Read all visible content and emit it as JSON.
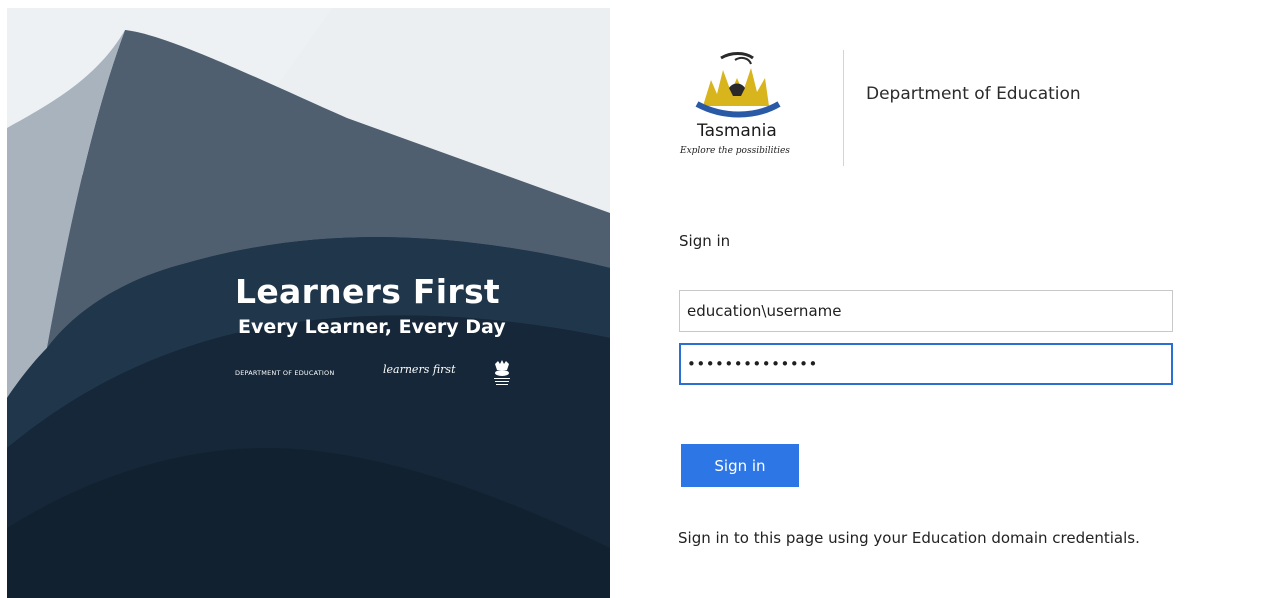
{
  "left_panel": {
    "title": "Learners First",
    "subtitle": "Every Learner, Every Day",
    "department": "DEPARTMENT OF EDUCATION",
    "wordmark": "learners first",
    "colors": {
      "background": "#152738",
      "shape_light": "#4f5f70",
      "shape_dark": "#20364b"
    }
  },
  "logo": {
    "name": "Tasmania",
    "tagline": "Explore the possibilities",
    "icon": "tasmanian-devil-logo-icon",
    "colors": {
      "gold": "#d8b41d",
      "blue": "#2a5aa6",
      "dark": "#2a2a2a"
    }
  },
  "header": {
    "department": "Department of Education"
  },
  "form": {
    "heading": "Sign in",
    "username_value": "education\\username",
    "password_value": "••••••••••••••",
    "submit_label": "Sign in",
    "help_text": "Sign in to this page using your Education domain credentials."
  },
  "colors": {
    "accent": "#2c76e6",
    "focus_border": "#2b6fd0"
  }
}
